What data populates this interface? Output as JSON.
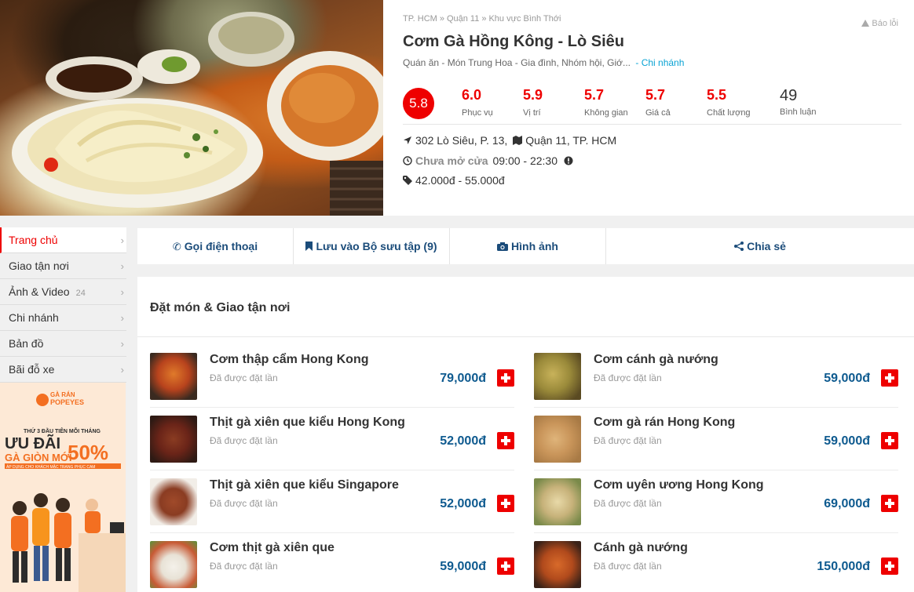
{
  "breadcrumb": [
    "TP. HCM",
    "Quận 11",
    "Khu vực Bình Thới"
  ],
  "breadcrumb_sep": "»",
  "report_label": "Báo lỗi",
  "restaurant": {
    "title": "Cơm Gà Hồng Kông - Lò Siêu",
    "categories": "Quán ăn  -  Món Trung Hoa - Gia đình, Nhóm hội, Giớ...",
    "branch_link": "- Chi nhánh",
    "overall_score": "5.8",
    "scores": [
      {
        "value": "6.0",
        "label": "Phục vụ"
      },
      {
        "value": "5.9",
        "label": "Vị trí"
      },
      {
        "value": "5.7",
        "label": "Không gian"
      },
      {
        "value": "5.7",
        "label": "Giá cả"
      },
      {
        "value": "5.5",
        "label": "Chất lượng"
      }
    ],
    "comments": {
      "value": "49",
      "label": "Bình luận"
    },
    "address_street": "302 Lò Siêu, P. 13,",
    "address_district": "Quận 11, TP. HCM",
    "status": "Chưa mở cửa",
    "hours": "09:00 - 22:30",
    "price_range": "42.000đ - 55.000đ"
  },
  "sidebar": {
    "items": [
      {
        "label": "Trang chủ",
        "active": true
      },
      {
        "label": "Giao tận nơi"
      },
      {
        "label": "Ảnh & Video",
        "count": "24"
      },
      {
        "label": "Chi nhánh"
      },
      {
        "label": "Bản đồ"
      },
      {
        "label": "Bãi đỗ xe"
      }
    ],
    "chevron": "›"
  },
  "promo": {
    "brand": "GÀ RÁN POPEYES",
    "line1": "THỨ 3 ĐẦU TIÊN MỖI THÁNG",
    "headline": "ƯU ĐÃI",
    "discount": "50%",
    "subline": "GÀ GIÒN MỚI",
    "footnote": "ÁP DỤNG CHO KHÁCH MẶC TRANG PHỤC CAM",
    "colors": {
      "bg": "#fde9d6",
      "orange": "#f36f21",
      "dark": "#2c2c2c"
    }
  },
  "actions": [
    {
      "label": "Gọi điện thoại",
      "icon": "phone-icon"
    },
    {
      "label": "Lưu vào Bộ sưu tập (9)",
      "icon": "bookmark-icon"
    },
    {
      "label": "Hình ảnh",
      "icon": "camera-icon"
    },
    {
      "label": "Chia sẻ",
      "icon": "share-icon"
    }
  ],
  "menu": {
    "heading": "Đặt món & Giao tận nơi",
    "order_note": "Đã được đặt lần",
    "items": [
      {
        "name": "Cơm thập cẩm Hong Kong",
        "price": "79,000đ",
        "thumb": "#b8431d"
      },
      {
        "name": "Cơm cánh gà nướng",
        "price": "59,000đ",
        "thumb": "#9a8a3a"
      },
      {
        "name": "Thịt gà xiên que kiểu Hong Kong",
        "price": "52,000đ",
        "thumb": "#6a2418"
      },
      {
        "name": "Cơm gà rán Hong Kong",
        "price": "59,000đ",
        "thumb": "#c9955a"
      },
      {
        "name": "Thịt gà xiên que kiểu Singapore",
        "price": "52,000đ",
        "thumb": "#8a3c22"
      },
      {
        "name": "Cơm uyên ương Hong Kong",
        "price": "69,000đ",
        "thumb": "#c7b27a"
      },
      {
        "name": "Cơm thịt gà xiên que",
        "price": "59,000đ",
        "thumb": "#c85a35"
      },
      {
        "name": "Cánh gà nướng",
        "price": "150,000đ",
        "thumb": "#b14a1c"
      }
    ]
  },
  "colors": {
    "accent": "#e00000",
    "price": "#0e5a8f",
    "link": "#0aa3d4",
    "action": "#1b4c7a"
  }
}
